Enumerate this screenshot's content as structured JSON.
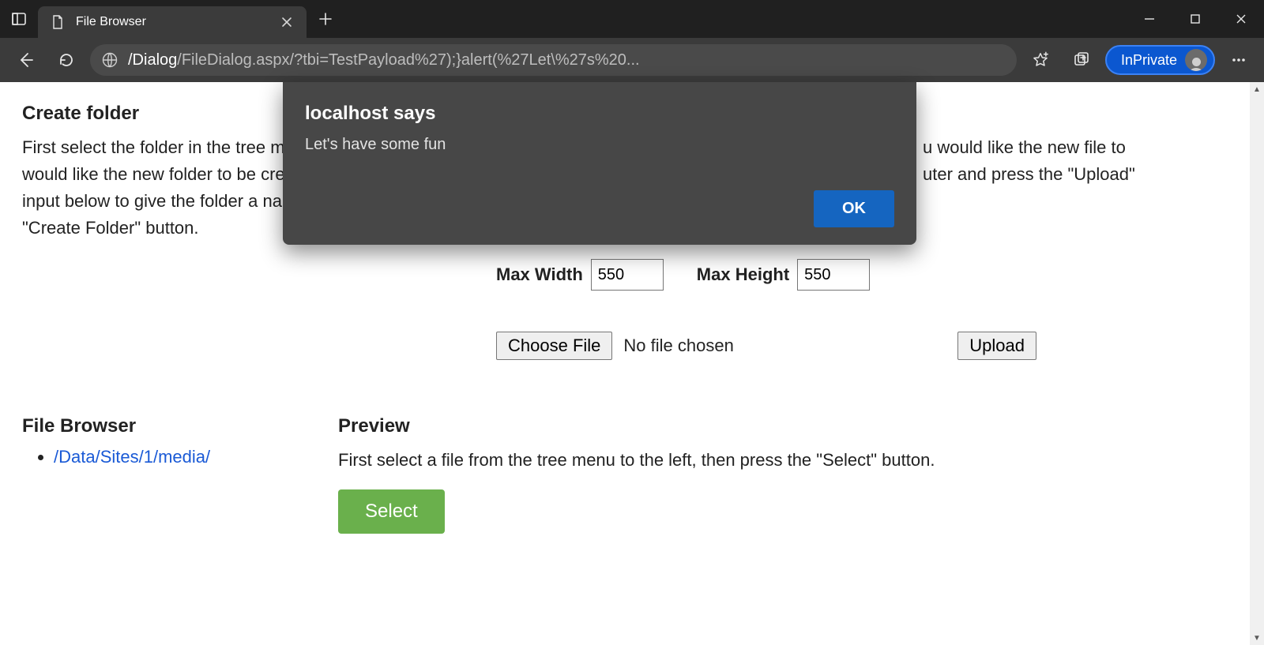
{
  "browser": {
    "tab_title": "File Browser",
    "url_prefix": "/Dialog",
    "url_rest": "/FileDialog.aspx/?tbi=TestPayload%27);}alert(%27Let\\%27s%20...",
    "inprivate_label": "InPrivate"
  },
  "alert": {
    "title": "localhost says",
    "message": "Let's have some fun",
    "ok": "OK"
  },
  "create_folder": {
    "heading": "Create folder",
    "text": "First select the folder in the tree menu below where you would like the new folder to be created, then use the input below to give the folder a name and press the \"Create Folder\" button."
  },
  "upload_hint_fragment1": "u would like the new file to",
  "upload_hint_fragment2": "uter and press the \"Upload\"",
  "dims": {
    "max_width_label": "Max Width",
    "max_width_value": "550",
    "max_height_label": "Max Height",
    "max_height_value": "550"
  },
  "file": {
    "choose_label": "Choose File",
    "no_file": "No file chosen",
    "upload_label": "Upload"
  },
  "file_browser": {
    "heading": "File Browser",
    "items": [
      {
        "label": "/Data/Sites/1/media/"
      }
    ]
  },
  "preview": {
    "heading": "Preview",
    "text": "First select a file from the tree menu to the left, then press the \"Select\" button.",
    "select_label": "Select"
  }
}
